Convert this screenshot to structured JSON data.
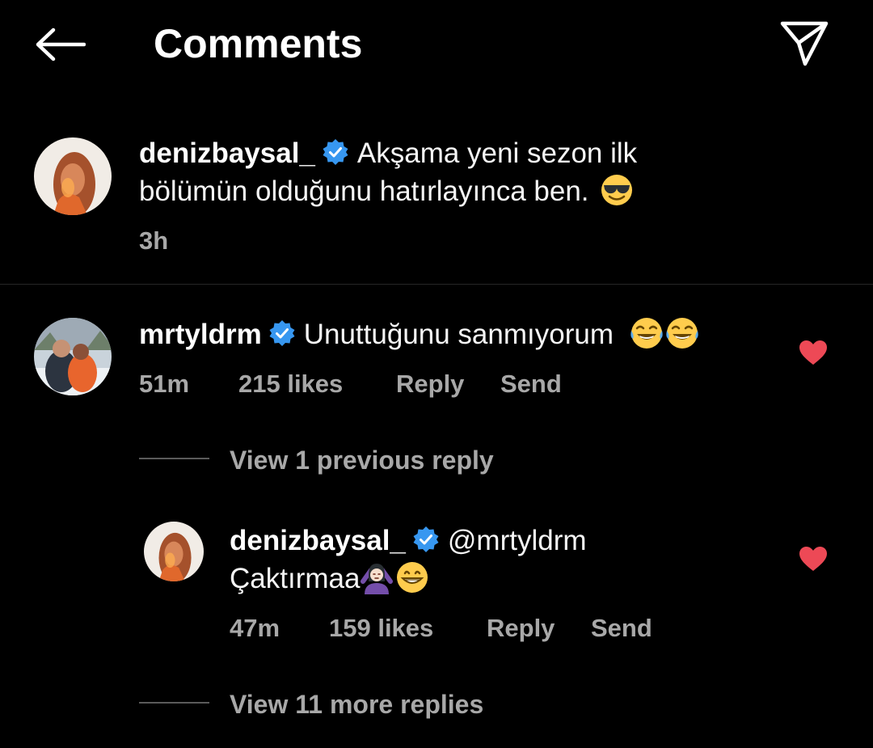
{
  "header": {
    "title": "Comments"
  },
  "comments": [
    {
      "username": "denizbaysal_",
      "text_line1": "Akşama yeni sezon ilk",
      "text_line2": "bölümün olduğunu hatırlayınca ben.",
      "emoji": "sunglasses-smile-emoji",
      "time": "3h"
    },
    {
      "username": "mrtyldrm",
      "text": "Unuttuğunu sanmıyorum",
      "emojis": [
        "tears-of-joy-emoji",
        "tears-of-joy-emoji"
      ],
      "time": "51m",
      "likes": "215 likes",
      "reply": "Reply",
      "send": "Send",
      "view_previous": "View 1 previous reply",
      "replies": [
        {
          "username": "denizbaysal_",
          "mention": "@mrtyldrm",
          "text": "Çaktırmaa",
          "emojis": [
            "no-gesture-woman-emoji",
            "grinning-emoji"
          ],
          "time": "47m",
          "likes": "159 likes",
          "reply": "Reply",
          "send": "Send"
        }
      ],
      "view_more": "View 11 more replies"
    }
  ],
  "colors": {
    "verified": "#3797f0",
    "heart": "#ed4956",
    "muted": "#a8a8a8"
  }
}
